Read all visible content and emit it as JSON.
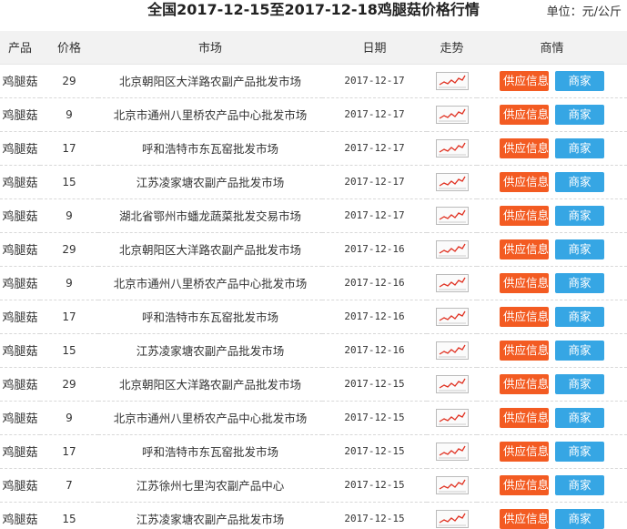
{
  "header": {
    "title": "全国2017-12-15至2017-12-18鸡腿菇价格行情",
    "unit": "单位：元/公斤"
  },
  "columns": [
    "产品",
    "价格",
    "市场",
    "日期",
    "走势",
    "商情"
  ],
  "buttons": {
    "supply": "供应信息",
    "merchant": "商家"
  },
  "rows": [
    {
      "product": "鸡腿菇",
      "price": "29",
      "market": "北京朝阳区大洋路农副产品批发市场",
      "date": "2017-12-17"
    },
    {
      "product": "鸡腿菇",
      "price": "9",
      "market": "北京市通州八里桥农产品中心批发市场",
      "date": "2017-12-17"
    },
    {
      "product": "鸡腿菇",
      "price": "17",
      "market": "呼和浩特市东瓦窑批发市场",
      "date": "2017-12-17"
    },
    {
      "product": "鸡腿菇",
      "price": "15",
      "market": "江苏凌家塘农副产品批发市场",
      "date": "2017-12-17"
    },
    {
      "product": "鸡腿菇",
      "price": "9",
      "market": "湖北省鄂州市蟠龙蔬菜批发交易市场",
      "date": "2017-12-17"
    },
    {
      "product": "鸡腿菇",
      "price": "29",
      "market": "北京朝阳区大洋路农副产品批发市场",
      "date": "2017-12-16"
    },
    {
      "product": "鸡腿菇",
      "price": "9",
      "market": "北京市通州八里桥农产品中心批发市场",
      "date": "2017-12-16"
    },
    {
      "product": "鸡腿菇",
      "price": "17",
      "market": "呼和浩特市东瓦窑批发市场",
      "date": "2017-12-16"
    },
    {
      "product": "鸡腿菇",
      "price": "15",
      "market": "江苏凌家塘农副产品批发市场",
      "date": "2017-12-16"
    },
    {
      "product": "鸡腿菇",
      "price": "29",
      "market": "北京朝阳区大洋路农副产品批发市场",
      "date": "2017-12-15"
    },
    {
      "product": "鸡腿菇",
      "price": "9",
      "market": "北京市通州八里桥农产品中心批发市场",
      "date": "2017-12-15"
    },
    {
      "product": "鸡腿菇",
      "price": "17",
      "market": "呼和浩特市东瓦窑批发市场",
      "date": "2017-12-15"
    },
    {
      "product": "鸡腿菇",
      "price": "7",
      "market": "江苏徐州七里沟农副产品中心",
      "date": "2017-12-15"
    },
    {
      "product": "鸡腿菇",
      "price": "15",
      "market": "江苏凌家塘农副产品批发市场",
      "date": "2017-12-15"
    }
  ],
  "icons": {
    "trend": "trend-chart-icon"
  },
  "colors": {
    "supply_button": "#f35b22",
    "merchant_button": "#36a6e4",
    "trend_line": "#e03020"
  }
}
